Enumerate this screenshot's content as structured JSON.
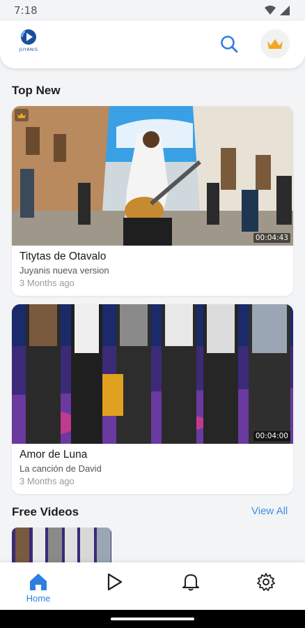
{
  "status_bar": {
    "time": "7:18"
  },
  "header": {
    "logo_text": "JUYANIS",
    "search_icon": "search-icon",
    "premium_icon": "crown-icon"
  },
  "sections": {
    "top_new": "Top New",
    "free_videos": "Free Videos",
    "view_all": "View All"
  },
  "top_new_items": [
    {
      "title": "Titytas de Otavalo",
      "subtitle": "Juyanis nueva version",
      "time": "3 Months ago",
      "duration": "00:04:43",
      "premium": true
    },
    {
      "title": "Amor de Luna",
      "subtitle": "La canción de David",
      "time": "3 Months ago",
      "duration": "00:04:00",
      "premium": false
    }
  ],
  "bottom_nav": {
    "items": [
      {
        "label": "Home",
        "icon": "home-icon",
        "active": true
      },
      {
        "label": "",
        "icon": "play-icon",
        "active": false
      },
      {
        "label": "",
        "icon": "bell-icon",
        "active": false
      },
      {
        "label": "",
        "icon": "gear-icon",
        "active": false
      }
    ]
  },
  "colors": {
    "accent": "#2e7fe0",
    "premium": "#f5a623",
    "background": "#f3f4f6"
  }
}
